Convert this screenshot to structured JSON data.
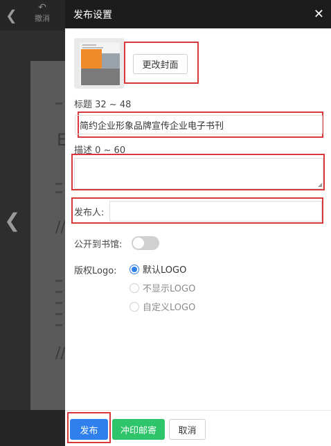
{
  "toolbar": {
    "back_icon": "chevron-left-icon",
    "undo_label": "撤消",
    "undo_icon": "undo-icon"
  },
  "drawer": {
    "title": "发布设置",
    "close_icon": "close-icon",
    "cover": {
      "change_label": "更改封面"
    },
    "title_field": {
      "label": "标题 32 ~ 48",
      "value": "简约企业形象品牌宣传企业电子书刊"
    },
    "desc_field": {
      "label": "描述 0 ~ 60",
      "value": ""
    },
    "publisher_field": {
      "label": "发布人:",
      "value": ""
    },
    "public": {
      "label": "公开到书馆:",
      "enabled": false
    },
    "logo": {
      "label": "版权Logo:",
      "options": [
        {
          "label": "默认LOGO",
          "checked": true
        },
        {
          "label": "不显示LOGO",
          "checked": false
        },
        {
          "label": "自定义LOGO",
          "checked": false
        }
      ]
    },
    "footer": {
      "publish_label": "发布",
      "print_label": "冲印邮寄",
      "cancel_label": "取消"
    }
  },
  "colors": {
    "primary": "#2f80ed",
    "success": "#2ec46a",
    "highlight": "#d9383a",
    "header": "#1c1c1c"
  }
}
